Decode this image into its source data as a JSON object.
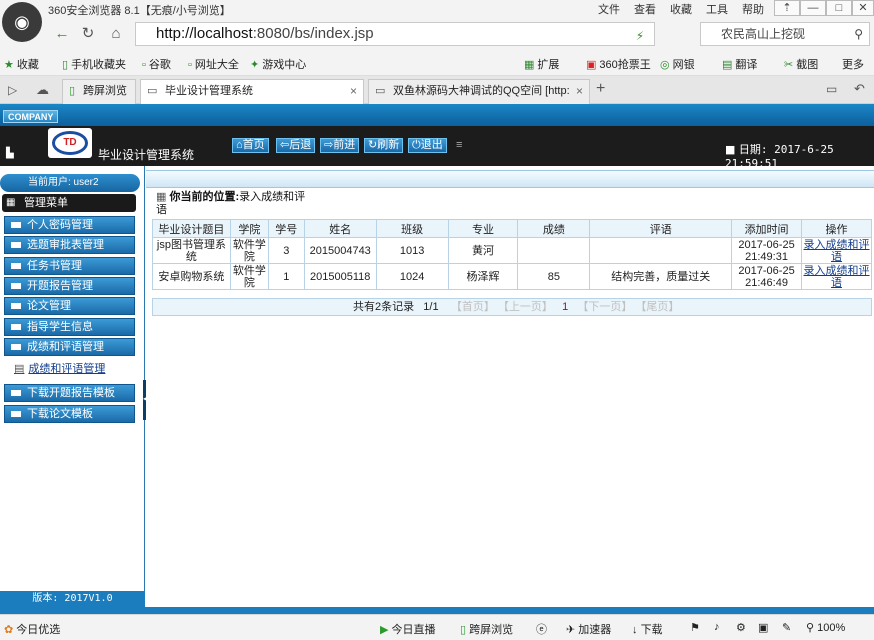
{
  "browser": {
    "window_title": "360安全浏览器 8.1【无痕/小号浏览】",
    "menu": [
      "文件",
      "查看",
      "收藏",
      "工具",
      "帮助"
    ],
    "url_host": "http://localhost",
    "url_rest": ":8080/bs/index.jsp",
    "search_placeholder": "农民高山上挖砚",
    "favorites": [
      "收藏",
      "手机收藏夹",
      "谷歌",
      "网址大全",
      "游戏中心"
    ],
    "right_tools": [
      "扩展",
      "360抢票王",
      "网银",
      "翻译",
      "截图",
      "更多"
    ],
    "tabs": [
      {
        "label": "跨屏浏览"
      },
      {
        "label": "毕业设计管理系统"
      },
      {
        "label": "双鱼林源码大神调试的QQ空间 [http:"
      }
    ],
    "new_tab": "+",
    "close_tab": "×"
  },
  "app": {
    "company": "COMPANY",
    "logo_text": "TD",
    "system_name": "毕业设计管理系统",
    "nav": [
      "首页",
      "后退",
      "前进",
      "刷新",
      "退出"
    ],
    "date_label": "日期: 2017-6-25 21:59:51",
    "current_user": "当前用户: user2",
    "menu_title": "管理菜单",
    "sidebar_items": [
      "个人密码管理",
      "选题审批表管理",
      "任务书管理",
      "开题报告管理",
      "论文管理",
      "指导学生信息",
      "成绩和评语管理"
    ],
    "sidebar_sub": "成绩和评语管理",
    "sidebar_items_after": [
      "下载开题报告模板",
      "下载论文模板"
    ],
    "version": "版本: 2017V1.0"
  },
  "content": {
    "location_label": "你当前的位置:",
    "location_value": "录入成绩和评语",
    "columns": [
      "毕业设计题目",
      "学院",
      "学号",
      "姓名",
      "班级",
      "专业",
      "成绩",
      "评语",
      "添加时间",
      "操作"
    ],
    "rows": [
      {
        "title": "jsp图书管理系统",
        "college": "软件学院",
        "no": "3",
        "name": "2015004743",
        "class": "1013",
        "major": "黄河",
        "score": "",
        "comment": "",
        "time": "2017-06-25 21:49:31",
        "action": "录入成绩和评语"
      },
      {
        "title": "安卓购物系统",
        "college": "软件学院",
        "no": "1",
        "name": "2015005118",
        "class": "1024",
        "major": "杨泽辉",
        "score": "85",
        "comment": "结构完善，质量过关",
        "time": "2017-06-25 21:46:49",
        "action": "录入成绩和评语"
      }
    ],
    "pager": {
      "total": "共有2条记录",
      "pages": "1/1",
      "first": "【首页】",
      "prev": "【上一页】",
      "current": "1",
      "next": "【下一页】",
      "last": "【尾页】"
    }
  },
  "statusbar": {
    "left": "今日优选",
    "items": [
      "今日直播",
      "跨屏浏览",
      "加速器",
      "下载"
    ],
    "zoom": "100%"
  }
}
